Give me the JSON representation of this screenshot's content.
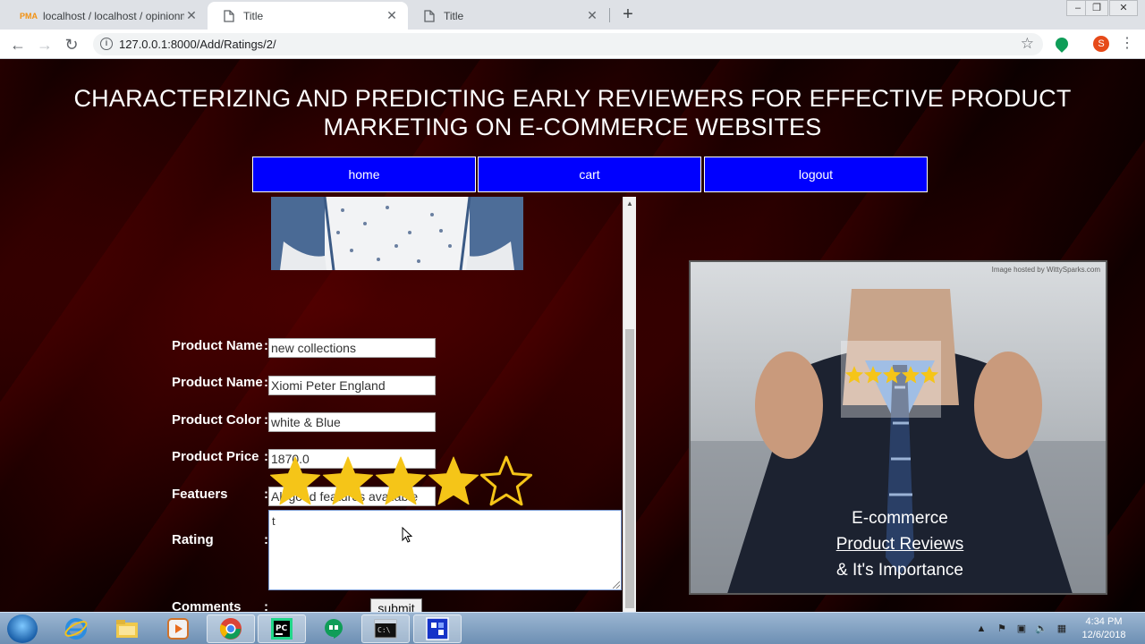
{
  "browser": {
    "tabs": [
      {
        "title": "localhost / localhost / opinionmi",
        "icon": "phpmyadmin-icon"
      },
      {
        "title": "Title",
        "icon": "document-icon"
      },
      {
        "title": "Title",
        "icon": "document-icon"
      }
    ],
    "address": "127.0.0.1:8000/Add/Ratings/2/",
    "profile_initial": "S"
  },
  "page": {
    "title_line1": "CHARACTERIZING AND PREDICTING EARLY REVIEWERS FOR EFFECTIVE PRODUCT",
    "title_line2": "MARKETING ON E-COMMERCE WEBSITES",
    "nav": [
      {
        "label": "home"
      },
      {
        "label": "cart"
      },
      {
        "label": "logout"
      }
    ],
    "form": {
      "fields": [
        {
          "label": "Product Name",
          "value": "new collections"
        },
        {
          "label": "Product Name",
          "value": "Xiomi Peter England"
        },
        {
          "label": "Product Color",
          "value": "white & Blue"
        },
        {
          "label": "Product Price",
          "value": "1870.0"
        },
        {
          "label": "Featuers",
          "value": "All good features available"
        }
      ],
      "rating_label": "Rating",
      "rating_value": 4,
      "rating_max": 5,
      "comments_label": "Comments",
      "comments_value": "t",
      "colon": ":",
      "submit_label": "submit"
    },
    "promo": {
      "credit": "Image hosted by WittySparks.com",
      "line1": "E-commerce",
      "line2": "Product Reviews",
      "line3": "& It's Importance"
    }
  },
  "taskbar": {
    "time": "4:34 PM",
    "date": "12/6/2018"
  },
  "colors": {
    "nav_button": "#0000ff",
    "star": "#f5c518",
    "page_background": "#2a0000"
  }
}
